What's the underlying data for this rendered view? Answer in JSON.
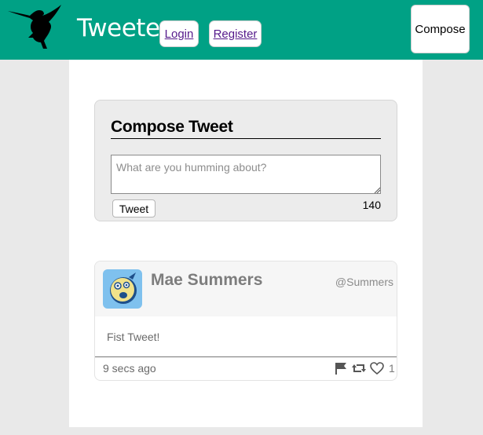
{
  "nav": {
    "brand": "Tweeter",
    "login_label": "Login",
    "register_label": "Register",
    "compose_label": "Compose",
    "accent_color": "#00a185"
  },
  "compose": {
    "title": "Compose Tweet",
    "placeholder": "What are you humming about?",
    "value": "",
    "tweet_label": "Tweet",
    "counter": "140"
  },
  "tweet": {
    "author": "Mae Summers",
    "handle": "@Summers",
    "body": "Fist Tweet!",
    "timestamp": "9 secs ago",
    "likes": "1",
    "icons": [
      "flag-icon",
      "retweet-icon",
      "heart-icon"
    ]
  }
}
